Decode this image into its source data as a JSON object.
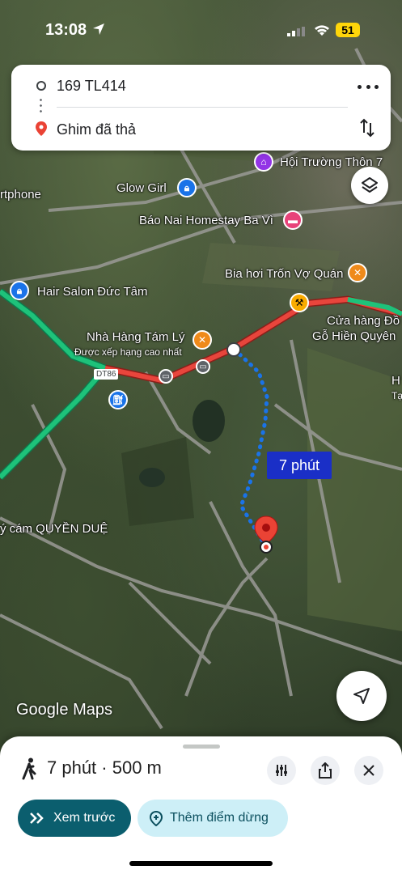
{
  "status_bar": {
    "time": "13:08",
    "battery": "51"
  },
  "route": {
    "origin": "169 TL414",
    "destination": "Ghim đã thả"
  },
  "map": {
    "labels": {
      "hoi_truong": "Hội Trường Thôn 7",
      "smartphone": "rtphone",
      "glow_girl": "Glow Girl",
      "bao_nai": "Báo Nai Homestay Ba Vì",
      "bia_hoi": "Bia hơi Trốn Vợ Quán",
      "hair_salon": "Hair Salon Đức Tâm",
      "cua_hang_line1": "Cửa hàng Đồ",
      "cua_hang_line2": "Gỗ Hiền Quyên",
      "nha_hang": "Nhà Hàng Tám Lý",
      "nha_hang_sub": "Được xếp hạng cao nhất",
      "dt86": "DT86",
      "quyen_due": "ý cám QUYỀN DUỆ",
      "right_edge_h": "H",
      "right_edge_ta": "Tạ"
    },
    "duration_bubble": "7 phút",
    "logo": {
      "google": "Google",
      "maps": "Maps"
    }
  },
  "sheet": {
    "summary": "7 phút · 500 m",
    "preview_label": "Xem trước",
    "add_stop_label": "Thêm điểm dừng"
  },
  "colors": {
    "route_blue": "#1a73e8",
    "traffic_green": "#1ec27a",
    "traffic_red": "#e8453c",
    "preview_bg": "#0b5e6e",
    "add_stop_bg": "#cdeff7",
    "pin_red": "#ea4335"
  }
}
